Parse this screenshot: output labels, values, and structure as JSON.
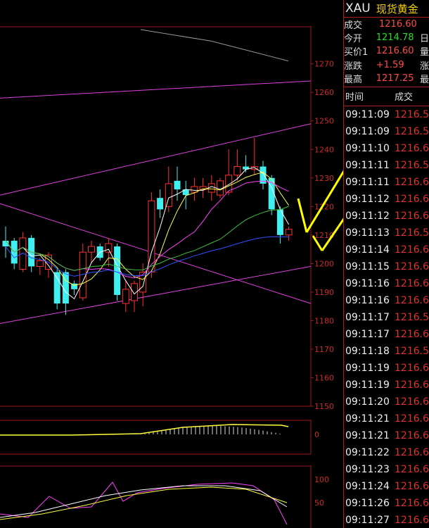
{
  "header": {
    "symbol": "XAU",
    "name": "现货黄金"
  },
  "quote": [
    {
      "label": "成交",
      "value": "1216.60",
      "trail": "",
      "color": "#ff4a4a"
    },
    {
      "label": "今开",
      "value": "1214.78",
      "trail": "日",
      "color": "#22e022"
    },
    {
      "label": "买价1",
      "value": "1216.60",
      "trail": "量",
      "color": "#ff4a4a"
    },
    {
      "label": "涨跌",
      "value": "+1.59",
      "trail": "涨",
      "color": "#ff4a4a"
    },
    {
      "label": "最高",
      "value": "1217.25",
      "trail": "最",
      "color": "#ff4a4a"
    }
  ],
  "ticks_header": {
    "time": "时间",
    "price": "成交"
  },
  "ticks": [
    {
      "time": "09:11:09",
      "price": "1216.5"
    },
    {
      "time": "09:11:09",
      "price": "1216.5"
    },
    {
      "time": "09:11:10",
      "price": "1216.6"
    },
    {
      "time": "09:11:11",
      "price": "1216.5"
    },
    {
      "time": "09:11:11",
      "price": "1216.6"
    },
    {
      "time": "09:11:12",
      "price": "1216.6"
    },
    {
      "time": "09:11:12",
      "price": "1216.6"
    },
    {
      "time": "09:11:13",
      "price": "1216.5"
    },
    {
      "time": "09:11:14",
      "price": "1216.6"
    },
    {
      "time": "09:11:15",
      "price": "1216.6"
    },
    {
      "time": "09:11:16",
      "price": "1216.6"
    },
    {
      "time": "09:11:16",
      "price": "1216.6"
    },
    {
      "time": "09:11:17",
      "price": "1216.5"
    },
    {
      "time": "09:11:17",
      "price": "1216.6"
    },
    {
      "time": "09:11:18",
      "price": "1216.5"
    },
    {
      "time": "09:11:19",
      "price": "1216.6"
    },
    {
      "time": "09:11:19",
      "price": "1216.6"
    },
    {
      "time": "09:11:20",
      "price": "1216.6"
    },
    {
      "time": "09:11:21",
      "price": "1216.6"
    },
    {
      "time": "09:11:21",
      "price": "1216.6"
    },
    {
      "time": "09:11:22",
      "price": "1216.6"
    },
    {
      "time": "09:11:23",
      "price": "1216.6"
    },
    {
      "time": "09:11:24",
      "price": "1216.6"
    },
    {
      "time": "09:11:26",
      "price": "1216.6"
    },
    {
      "time": "09:11:27",
      "price": "1216.6"
    }
  ],
  "colors": {
    "up": "#ff3030",
    "down": "#40f0f0",
    "ma1": "#ffffff",
    "ma2": "#ffff40",
    "ma3": "#ff40ff",
    "ma4": "#40c040",
    "ma5": "#3050ff",
    "trend": "#e040e0",
    "grid": "#a01818",
    "arrow": "#ffff00"
  },
  "chart_data": {
    "type": "candlestick",
    "y_ticks": [
      "1270",
      "1260",
      "1250",
      "1240",
      "1230",
      "1220",
      "1210",
      "1200",
      "1190",
      "1180",
      "1170",
      "1160",
      "1150"
    ],
    "ylim": [
      1150,
      1283
    ],
    "candles": [
      {
        "o": 1206,
        "h": 1213,
        "l": 1202,
        "c": 1208,
        "dir": "dn"
      },
      {
        "o": 1208,
        "h": 1209,
        "l": 1198,
        "c": 1200,
        "dir": "dn"
      },
      {
        "o": 1198,
        "h": 1211,
        "l": 1197,
        "c": 1209,
        "dir": "up"
      },
      {
        "o": 1209,
        "h": 1210,
        "l": 1197,
        "c": 1199,
        "dir": "dn"
      },
      {
        "o": 1199,
        "h": 1202,
        "l": 1196,
        "c": 1201,
        "dir": "up"
      },
      {
        "o": 1203,
        "h": 1204,
        "l": 1195,
        "c": 1198,
        "dir": "up"
      },
      {
        "o": 1197,
        "h": 1198,
        "l": 1184,
        "c": 1186,
        "dir": "dn"
      },
      {
        "o": 1197,
        "h": 1198,
        "l": 1182,
        "c": 1186,
        "dir": "dn"
      },
      {
        "o": 1193,
        "h": 1194,
        "l": 1189,
        "c": 1191,
        "dir": "dn"
      },
      {
        "o": 1188,
        "h": 1207,
        "l": 1187,
        "c": 1204,
        "dir": "up"
      },
      {
        "o": 1204,
        "h": 1208,
        "l": 1200,
        "c": 1206,
        "dir": "up"
      },
      {
        "o": 1206,
        "h": 1207,
        "l": 1201,
        "c": 1202,
        "dir": "dn"
      },
      {
        "o": 1204,
        "h": 1209,
        "l": 1199,
        "c": 1207,
        "dir": "up"
      },
      {
        "o": 1206,
        "h": 1207,
        "l": 1187,
        "c": 1189,
        "dir": "dn"
      },
      {
        "o": 1191,
        "h": 1194,
        "l": 1183,
        "c": 1186,
        "dir": "up"
      },
      {
        "o": 1187,
        "h": 1194,
        "l": 1183,
        "c": 1193,
        "dir": "up"
      },
      {
        "o": 1190,
        "h": 1200,
        "l": 1185,
        "c": 1197,
        "dir": "up"
      },
      {
        "o": 1197,
        "h": 1225,
        "l": 1195,
        "c": 1222,
        "dir": "up"
      },
      {
        "o": 1223,
        "h": 1226,
        "l": 1216,
        "c": 1219,
        "dir": "dn"
      },
      {
        "o": 1220,
        "h": 1234,
        "l": 1218,
        "c": 1228,
        "dir": "up"
      },
      {
        "o": 1229,
        "h": 1234,
        "l": 1222,
        "c": 1226,
        "dir": "dn"
      },
      {
        "o": 1226,
        "h": 1229,
        "l": 1219,
        "c": 1224,
        "dir": "dn"
      },
      {
        "o": 1225,
        "h": 1230,
        "l": 1222,
        "c": 1227,
        "dir": "up"
      },
      {
        "o": 1227,
        "h": 1230,
        "l": 1223,
        "c": 1226,
        "dir": "up"
      },
      {
        "o": 1225,
        "h": 1231,
        "l": 1222,
        "c": 1228,
        "dir": "up"
      },
      {
        "o": 1229,
        "h": 1230,
        "l": 1223,
        "c": 1224,
        "dir": "up"
      },
      {
        "o": 1225,
        "h": 1240,
        "l": 1224,
        "c": 1231,
        "dir": "up"
      },
      {
        "o": 1231,
        "h": 1240,
        "l": 1229,
        "c": 1234,
        "dir": "up"
      },
      {
        "o": 1233,
        "h": 1238,
        "l": 1232,
        "c": 1234,
        "dir": "dn"
      },
      {
        "o": 1234,
        "h": 1244,
        "l": 1231,
        "c": 1233,
        "dir": "up"
      },
      {
        "o": 1234,
        "h": 1236,
        "l": 1226,
        "c": 1228,
        "dir": "dn"
      },
      {
        "o": 1230,
        "h": 1231,
        "l": 1217,
        "c": 1219,
        "dir": "dn"
      },
      {
        "o": 1219,
        "h": 1220,
        "l": 1207,
        "c": 1210,
        "dir": "dn"
      },
      {
        "o": 1210,
        "h": 1213,
        "l": 1208,
        "c": 1212,
        "dir": "up"
      }
    ]
  }
}
